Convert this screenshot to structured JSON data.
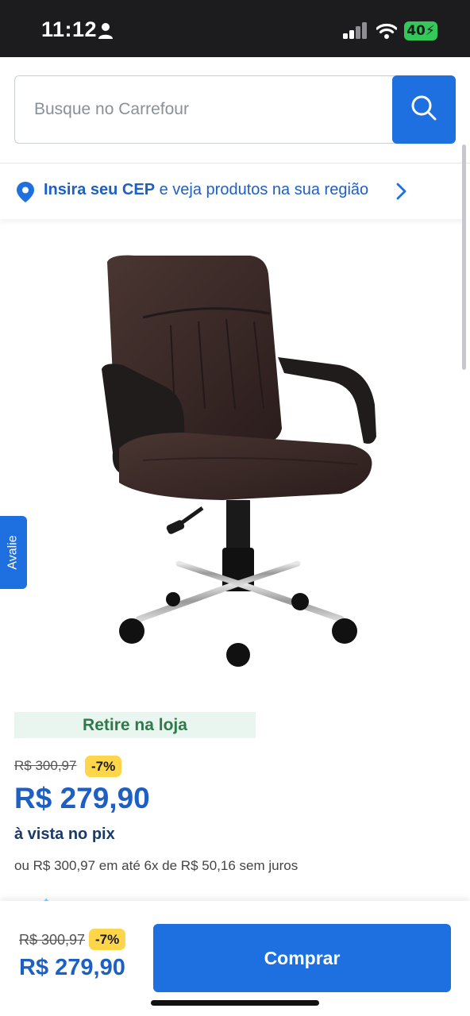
{
  "status_bar": {
    "time": "11:12",
    "battery": "40",
    "icons": [
      "person-icon",
      "signal-icon",
      "wifi-icon",
      "battery-icon"
    ]
  },
  "search": {
    "placeholder": "Busque no Carrefour",
    "icon": "search-icon"
  },
  "cep": {
    "strong": "Insira seu CEP",
    "rest": " e veja produtos na sua região",
    "icon": "location-pin-icon"
  },
  "product": {
    "image": "office-chair-brown",
    "pickup": "Retire na loja",
    "old_price": "R$ 300,97",
    "discount": "-7%",
    "price": "R$ 279,90",
    "pix_label": "à vista no pix",
    "installments": "ou R$ 300,97 em até 6x de R$ 50,16 sem juros"
  },
  "side_tab": {
    "label": "Avalie"
  },
  "bottom_bar": {
    "old_price": "R$ 300,97",
    "discount": "-7%",
    "price": "R$ 279,90",
    "buy_label": "Comprar"
  },
  "colors": {
    "primary_blue": "#1e6fe0",
    "price_blue": "#1e5fc4",
    "badge_yellow": "#ffd54a",
    "pickup_green_bg": "#e8f6ef",
    "pickup_green_text": "#2f7a4b"
  }
}
